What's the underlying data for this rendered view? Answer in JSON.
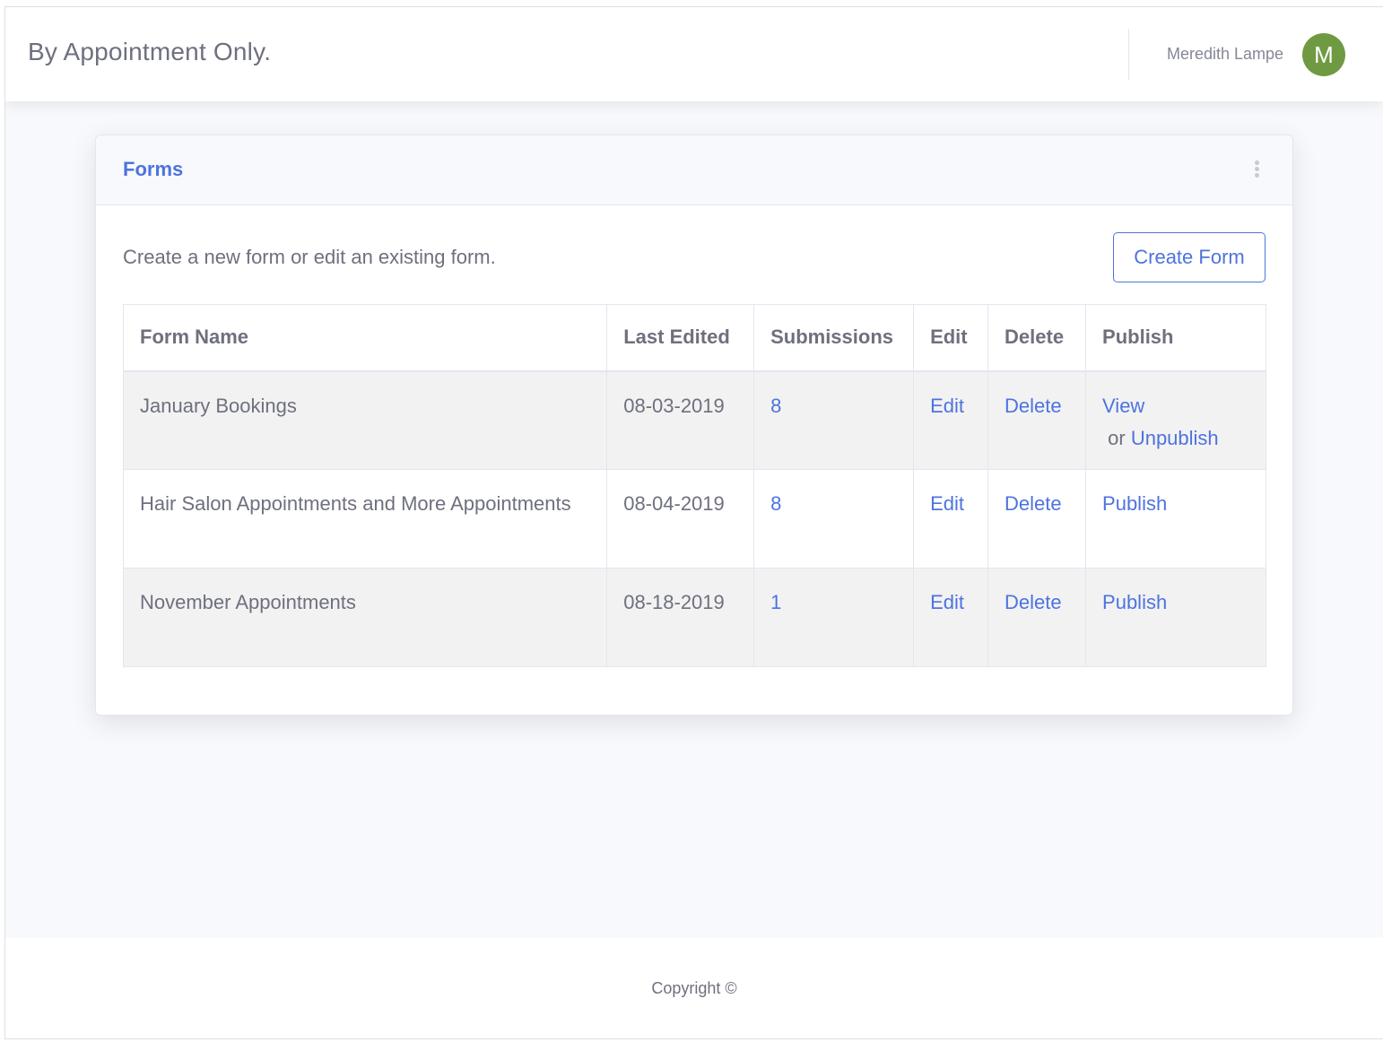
{
  "topbar": {
    "brand": "By Appointment Only.",
    "user_name": "Meredith Lampe",
    "avatar_initial": "M",
    "avatar_color": "#6f9a42"
  },
  "card": {
    "title": "Forms",
    "menu_icon": "vertical-ellipsis-icon",
    "intro": "Create a new form or edit an existing form.",
    "create_button": "Create Form"
  },
  "table": {
    "headers": [
      "Form Name",
      "Last Edited",
      "Submissions",
      "Edit",
      "Delete",
      "Publish"
    ],
    "rows": [
      {
        "name": "January Bookings",
        "last_edited": "08-03-2019",
        "submissions": "8",
        "edit": "Edit",
        "delete": "Delete",
        "publish_view": "View",
        "publish_or": " or ",
        "publish_action": "Unpublish"
      },
      {
        "name": "Hair Salon Appointments and More Appointments",
        "last_edited": "08-04-2019",
        "submissions": "8",
        "edit": "Edit",
        "delete": "Delete",
        "publish_action": "Publish"
      },
      {
        "name": "November Appointments",
        "last_edited": "08-18-2019",
        "submissions": "1",
        "edit": "Edit",
        "delete": "Delete",
        "publish_action": "Publish"
      }
    ]
  },
  "footer": {
    "copyright": "Copyright ©"
  },
  "colors": {
    "accent": "#4e73df",
    "text": "#6e707e",
    "stripe": "#f2f2f2"
  }
}
